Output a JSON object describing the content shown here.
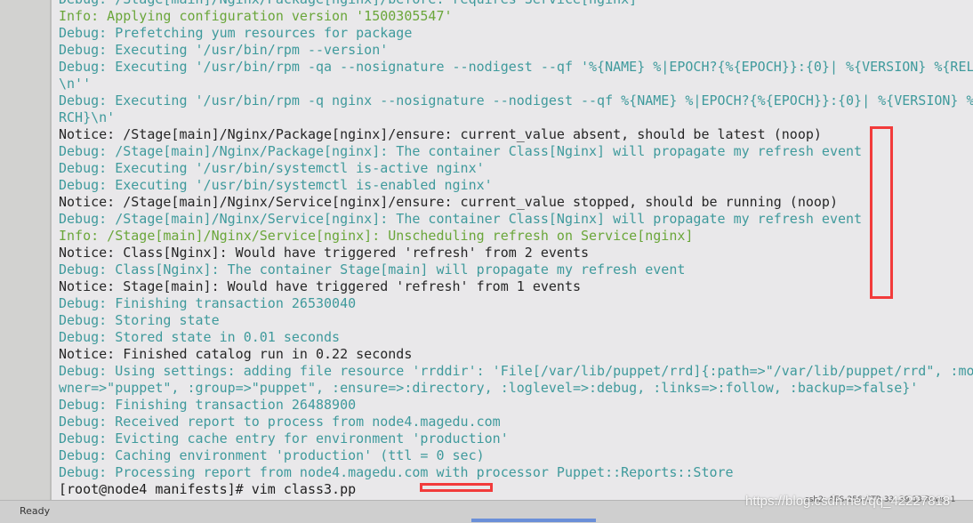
{
  "terminal": {
    "lines": [
      {
        "level": "debug",
        "text": "Debug: /Stage[main]/Nginx/Package[nginx]/before: requires Service[nginx]"
      },
      {
        "level": "info",
        "text": "Info: Applying configuration version '1500305547'"
      },
      {
        "level": "debug",
        "text": "Debug: Prefetching yum resources for package"
      },
      {
        "level": "debug",
        "text": "Debug: Executing '/usr/bin/rpm --version'"
      },
      {
        "level": "debug",
        "text": "Debug: Executing '/usr/bin/rpm -qa --nosignature --nodigest --qf '%{NAME} %|EPOCH?{%{EPOCH}}:{0}| %{VERSION} %{RELEA"
      },
      {
        "level": "debug",
        "text": "\\n''"
      },
      {
        "level": "debug",
        "text": "Debug: Executing '/usr/bin/rpm -q nginx --nosignature --nodigest --qf %{NAME} %|EPOCH?{%{EPOCH}}:{0}| %{VERSION} %{R"
      },
      {
        "level": "debug",
        "text": "RCH}\\n'"
      },
      {
        "level": "notice",
        "text": "Notice: /Stage[main]/Nginx/Package[nginx]/ensure: current_value absent, should be latest (noop)"
      },
      {
        "level": "debug",
        "text": "Debug: /Stage[main]/Nginx/Package[nginx]: The container Class[Nginx] will propagate my refresh event"
      },
      {
        "level": "debug",
        "text": "Debug: Executing '/usr/bin/systemctl is-active nginx'"
      },
      {
        "level": "debug",
        "text": "Debug: Executing '/usr/bin/systemctl is-enabled nginx'"
      },
      {
        "level": "notice",
        "text": "Notice: /Stage[main]/Nginx/Service[nginx]/ensure: current_value stopped, should be running (noop)"
      },
      {
        "level": "debug",
        "text": "Debug: /Stage[main]/Nginx/Service[nginx]: The container Class[Nginx] will propagate my refresh event"
      },
      {
        "level": "info",
        "text": "Info: /Stage[main]/Nginx/Service[nginx]: Unscheduling refresh on Service[nginx]"
      },
      {
        "level": "notice",
        "text": "Notice: Class[Nginx]: Would have triggered 'refresh' from 2 events"
      },
      {
        "level": "debug",
        "text": "Debug: Class[Nginx]: The container Stage[main] will propagate my refresh event"
      },
      {
        "level": "notice",
        "text": "Notice: Stage[main]: Would have triggered 'refresh' from 1 events"
      },
      {
        "level": "debug",
        "text": "Debug: Finishing transaction 26530040"
      },
      {
        "level": "debug",
        "text": "Debug: Storing state"
      },
      {
        "level": "debug",
        "text": "Debug: Stored state in 0.01 seconds"
      },
      {
        "level": "notice",
        "text": "Notice: Finished catalog run in 0.22 seconds"
      },
      {
        "level": "debug",
        "text": "Debug: Using settings: adding file resource 'rrddir': 'File[/var/lib/puppet/rrd]{:path=>\"/var/lib/puppet/rrd\", :mode"
      },
      {
        "level": "debug",
        "text": "wner=>\"puppet\", :group=>\"puppet\", :ensure=>:directory, :loglevel=>:debug, :links=>:follow, :backup=>false}'"
      },
      {
        "level": "debug",
        "text": "Debug: Finishing transaction 26488900"
      },
      {
        "level": "debug",
        "text": "Debug: Received report to process from node4.magedu.com"
      },
      {
        "level": "debug",
        "text": "Debug: Evicting cache entry for environment 'production'"
      },
      {
        "level": "debug",
        "text": "Debug: Caching environment 'production' (ttl = 0 sec)"
      },
      {
        "level": "debug",
        "text": "Debug: Processing report from node4.magedu.com with processor Puppet::Reports::Store"
      },
      {
        "level": "prompt",
        "text": "[root@node4 manifests]# vim class3.pp"
      }
    ]
  },
  "statusbar": {
    "status": "Ready",
    "session_info": "ssh2: AES-256-CTR    33, 39  33 Rows, 1",
    "watermark": "https://blog.csdn.net/qq_42227818"
  },
  "colors": {
    "debug": "#3f9a9c",
    "info": "#6aa63a",
    "notice": "#262626",
    "highlight": "#f23b3b"
  }
}
